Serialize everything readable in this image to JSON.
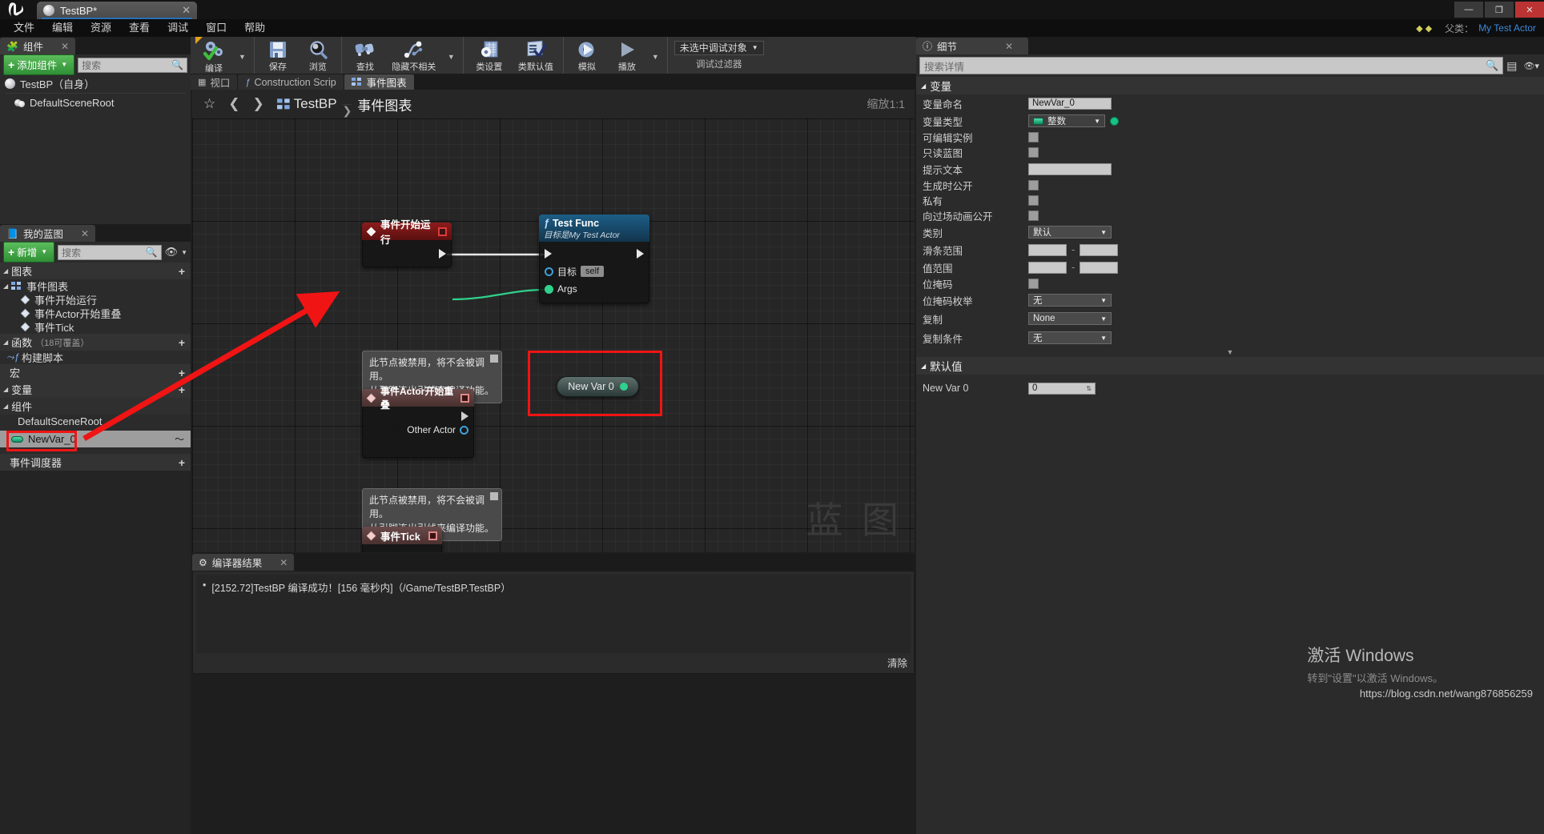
{
  "titlebar": {
    "logo": "unreal-logo",
    "tab_label": "TestBP*",
    "tab_close": "✕",
    "minimize": "—",
    "maximize": "❐",
    "close": "✕"
  },
  "menubar": {
    "items": [
      "文件",
      "编辑",
      "资源",
      "查看",
      "调试",
      "窗口",
      "帮助"
    ],
    "parent_label": "父类：",
    "parent_value": "My Test Actor",
    "arrows": "◆ ◆"
  },
  "components_panel": {
    "tab_label": "组件",
    "tab_close": "✕",
    "add_button": "添加组件",
    "search_placeholder": "搜索",
    "items": [
      {
        "label": "TestBP（自身）",
        "icon": "sphere-icon"
      },
      {
        "label": "DefaultSceneRoot",
        "icon": "scene-root-icon"
      }
    ]
  },
  "myblueprint_panel": {
    "tab_label": "我的蓝图",
    "tab_close": "✕",
    "add_button": "新增",
    "search_placeholder": "搜索",
    "sections": [
      {
        "title": "图表",
        "sub": "",
        "plus": "+"
      },
      {
        "title": "事件图表",
        "sub": "",
        "plus": "",
        "nested": true
      },
      {
        "title": "函数",
        "sub": "（18可覆盖）",
        "plus": "+"
      },
      {
        "title": "宏",
        "sub": "",
        "plus": "+"
      },
      {
        "title": "变量",
        "sub": "",
        "plus": "+"
      },
      {
        "title": "组件",
        "sub": "",
        "plus": ""
      },
      {
        "title": "事件调度器",
        "sub": "",
        "plus": "+"
      }
    ],
    "graph_events": [
      "事件开始运行",
      "事件Actor开始重叠",
      "事件Tick"
    ],
    "functions": [
      "构建脚本"
    ],
    "component_vars": [
      "DefaultSceneRoot"
    ],
    "variables": [
      "NewVar_0"
    ],
    "selected_variable": "NewVar_0"
  },
  "toolbar": {
    "groups": [
      {
        "items": [
          {
            "label": "编译",
            "icon": "compile-icon",
            "caret": true
          }
        ]
      },
      {
        "items": [
          {
            "label": "保存",
            "icon": "save-icon",
            "caret": false
          },
          {
            "label": "浏览",
            "icon": "browse-icon",
            "caret": false
          }
        ]
      },
      {
        "items": [
          {
            "label": "查找",
            "icon": "find-icon",
            "caret": false
          },
          {
            "label": "隐藏不相关",
            "icon": "hide-unrelated-icon",
            "caret": true
          }
        ]
      },
      {
        "items": [
          {
            "label": "类设置",
            "icon": "class-settings-icon",
            "caret": false
          },
          {
            "label": "类默认值",
            "icon": "class-defaults-icon",
            "caret": false
          }
        ]
      },
      {
        "items": [
          {
            "label": "模拟",
            "icon": "simulate-icon",
            "caret": false
          },
          {
            "label": "播放",
            "icon": "play-icon",
            "caret": true
          }
        ]
      }
    ],
    "debug_selector": "未选中调试对象",
    "debug_filter_label": "调试过滤器"
  },
  "graph_tabs": [
    {
      "label": "视口",
      "icon": "viewport-icon",
      "active": false
    },
    {
      "label": "Construction Scrip",
      "icon": "function-icon",
      "active": false
    },
    {
      "label": "事件图表",
      "icon": "graph-icon",
      "active": true
    }
  ],
  "graph": {
    "breadcrumb_root": "TestBP",
    "breadcrumb_sep": "❯",
    "breadcrumb_leaf": "事件图表",
    "star": "☆",
    "back": "❮",
    "forward": "❯",
    "zoom_label": "缩放1:1",
    "watermark": "蓝 图",
    "nodes": [
      {
        "name": "event-begin-play",
        "title": "事件开始运行",
        "type": "event",
        "exec_out": true,
        "badge": "breakpoint-square"
      },
      {
        "name": "test-func",
        "title": "Test Func",
        "subtitle": "目标是My Test Actor",
        "type": "function",
        "pins": [
          {
            "label": "目标",
            "value": "self",
            "kind": "object"
          },
          {
            "label": "Args",
            "value": "",
            "kind": "wildcard"
          }
        ]
      },
      {
        "name": "get-new-var-0",
        "title": "New Var 0",
        "type": "variable-get"
      },
      {
        "name": "event-actor-begin-overlap",
        "title": "事件Actor开始重叠",
        "type": "event-disabled",
        "out_pin_label": "Other Actor",
        "comment": "此节点被禁用，将不会被调用。\n从引脚连出引线来编译功能。"
      },
      {
        "name": "event-tick",
        "title": "事件Tick",
        "type": "event-disabled",
        "comment": "此节点被禁用，将不会被调用。\n从引脚连出引线来编译功能。"
      }
    ]
  },
  "compiler_results": {
    "tab_label": "编译器结果",
    "tab_close": "✕",
    "messages": [
      "[2152.72]TestBP 编译成功！[156 毫秒内]（/Game/TestBP.TestBP）"
    ],
    "clear_label": "清除"
  },
  "details_panel": {
    "tab_label": "细节",
    "tab_close": "✕",
    "search_placeholder": "搜索详情",
    "sections": [
      {
        "title": "变量",
        "rows": [
          {
            "label": "变量命名",
            "type": "text",
            "value": "NewVar_0"
          },
          {
            "label": "变量类型",
            "type": "type",
            "value": "整数"
          },
          {
            "label": "可编辑实例",
            "type": "checkbox",
            "value": ""
          },
          {
            "label": "只读蓝图",
            "type": "checkbox",
            "value": ""
          },
          {
            "label": "提示文本",
            "type": "text",
            "value": ""
          },
          {
            "label": "生成时公开",
            "type": "checkbox",
            "value": ""
          },
          {
            "label": "私有",
            "type": "checkbox",
            "value": ""
          },
          {
            "label": "向过场动画公开",
            "type": "checkbox",
            "value": ""
          },
          {
            "label": "类别",
            "type": "dropdown",
            "value": "默认"
          },
          {
            "label": "滑条范围",
            "type": "range",
            "value": "",
            "value2": ""
          },
          {
            "label": "值范围",
            "type": "range",
            "value": "",
            "value2": ""
          },
          {
            "label": "位掩码",
            "type": "checkbox",
            "value": ""
          },
          {
            "label": "位掩码枚举",
            "type": "dropdown",
            "value": "无"
          },
          {
            "label": "复制",
            "type": "dropdown",
            "value": "None"
          },
          {
            "label": "复制条件",
            "type": "dropdown",
            "value": "无"
          }
        ]
      },
      {
        "title": "默认值",
        "rows": [
          {
            "label": "New Var 0",
            "type": "number",
            "value": "0"
          }
        ]
      }
    ]
  },
  "watermark": {
    "activate_title": "激活 Windows",
    "activate_sub": "转到\"设置\"以激活 Windows。",
    "blog_url": "https://blog.csdn.net/wang876856259"
  },
  "colors": {
    "accent_green": "#2f8f36",
    "event_red": "#8d1c1c",
    "function_blue": "#1d5e86",
    "highlight_red": "#f01414",
    "link_blue": "#3c8ad9"
  }
}
